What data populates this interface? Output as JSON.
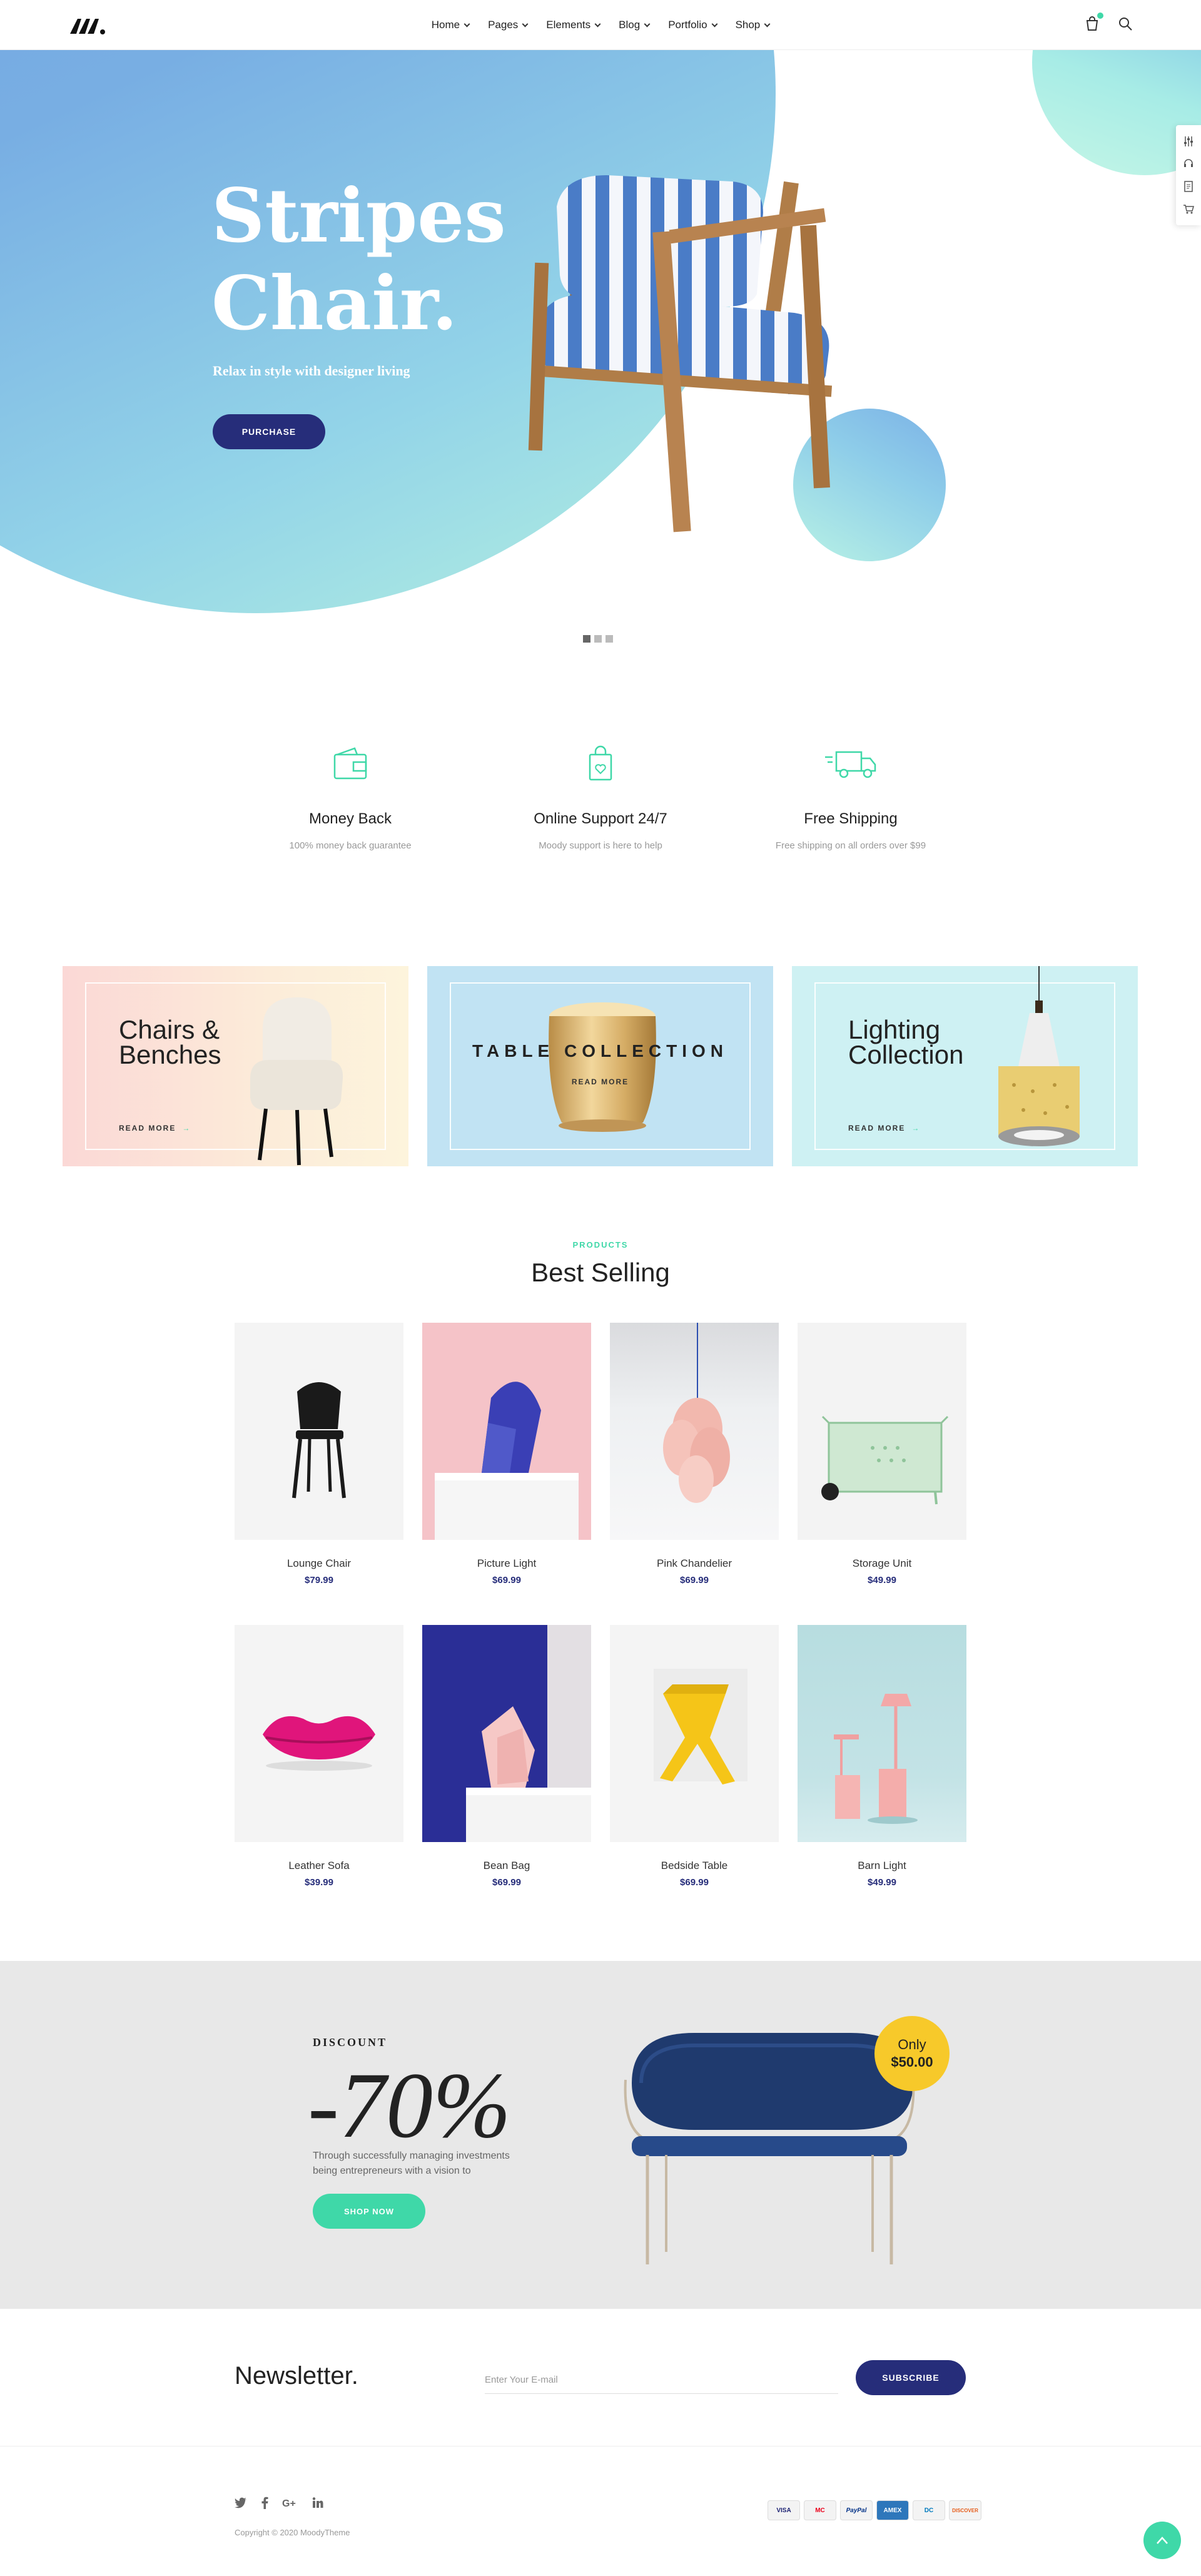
{
  "header": {
    "nav": [
      {
        "label": "Home"
      },
      {
        "label": "Pages"
      },
      {
        "label": "Elements"
      },
      {
        "label": "Blog"
      },
      {
        "label": "Portfolio"
      },
      {
        "label": "Shop"
      }
    ],
    "icons": [
      "logo-icon",
      "cart-icon",
      "search-icon"
    ]
  },
  "hero": {
    "title_line1": "Stripes",
    "title_line2": "Chair.",
    "subtitle": "Relax in style with designer living",
    "button": "PURCHASE",
    "slides_total": 3,
    "active_slide": 1
  },
  "side_tools": [
    "settings-icon",
    "support-icon",
    "document-icon",
    "cart-icon"
  ],
  "features": [
    {
      "icon": "wallet-icon",
      "title": "Money Back",
      "desc": "100% money back guarantee"
    },
    {
      "icon": "shopping-bag-icon",
      "title": "Online Support 24/7",
      "desc": "Moody support is here to help"
    },
    {
      "icon": "truck-icon",
      "title": "Free Shipping",
      "desc": "Free shipping on all orders over $99"
    }
  ],
  "banners": [
    {
      "title_line1": "Chairs &",
      "title_line2": "Benches",
      "more": "READ MORE",
      "bg": "#fde3d8"
    },
    {
      "title": "TABLE COLLECTION",
      "more": "READ MORE",
      "bg": "#bfe2f2"
    },
    {
      "title_line1": "Lighting",
      "title_line2": "Collection",
      "more": "READ MORE",
      "bg": "#cdf0f2"
    }
  ],
  "products_section": {
    "kicker": "PRODUCTS",
    "title": "Best Selling",
    "items": [
      {
        "name": "Lounge Chair",
        "price": "$79.99"
      },
      {
        "name": "Picture Light",
        "price": "$69.99"
      },
      {
        "name": "Pink Chandelier",
        "price": "$69.99"
      },
      {
        "name": "Storage Unit",
        "price": "$49.99"
      },
      {
        "name": "Leather Sofa",
        "price": "$39.99"
      },
      {
        "name": "Bean Bag",
        "price": "$69.99"
      },
      {
        "name": "Bedside Table",
        "price": "$69.99"
      },
      {
        "name": "Barn Light",
        "price": "$49.99"
      }
    ]
  },
  "discount": {
    "kicker": "DISCOUNT",
    "value": "-70%",
    "text_line1": "Through successfully managing investments",
    "text_line2": "being entrepreneurs with a vision to",
    "button": "SHOP NOW",
    "badge_top": "Only",
    "badge_price": "$50.00"
  },
  "newsletter": {
    "title": "Newsletter.",
    "placeholder": "Enter Your E-mail",
    "button": "SUBSCRIBE"
  },
  "footer": {
    "socials": [
      "twitter-icon",
      "facebook-icon",
      "google-plus-icon",
      "linkedin-icon"
    ],
    "copyright": "Copyright © 2020 MoodyTheme",
    "payments": [
      {
        "label": "VISA"
      },
      {
        "label": "MC"
      },
      {
        "label": "PayPal"
      },
      {
        "label": "AMEX"
      },
      {
        "label": "DC"
      },
      {
        "label": "DISCOVER"
      }
    ]
  },
  "colors": {
    "accent": "#3fd8a8",
    "navy": "#262d7a",
    "badge": "#f7c92a"
  }
}
